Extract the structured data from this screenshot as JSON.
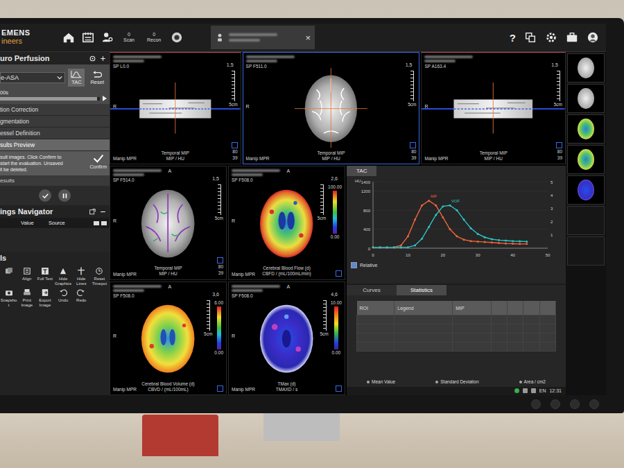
{
  "brand": {
    "text": "EMENS",
    "sub": "ineers"
  },
  "toolbar": {
    "counters": [
      {
        "count": "0",
        "label": "Scan"
      },
      {
        "count": "0",
        "label": "Recon"
      }
    ]
  },
  "patient_tab": {
    "close": "×"
  },
  "help": "?",
  "left_panel": {
    "title": "uro Perfusion",
    "protocol": "e-ASA",
    "tac_button": "TAC",
    "reset_button": "Reset",
    "time_label": "00s",
    "time_level": 0.97,
    "steps": [
      {
        "label": "tion Correction",
        "selected": false
      },
      {
        "label": "gmentation",
        "selected": false
      },
      {
        "label": "essel Definition",
        "selected": false
      },
      {
        "label": "sults Preview",
        "selected": true
      }
    ],
    "message": [
      "sult images. Click Confirm to",
      "start the evaluation. Unsaved",
      "ll be deleted."
    ],
    "confirm": "Confirm",
    "results": "esults"
  },
  "findings_navigator": {
    "title": "ings Navigator",
    "columns": [
      "Value",
      "Source"
    ]
  },
  "tools": {
    "title": "ls",
    "items": [
      {
        "label": ""
      },
      {
        "label": "Align"
      },
      {
        "label": "Full Text"
      },
      {
        "label": "Hide Graphics"
      },
      {
        "label": "Hide Lines"
      },
      {
        "label": "Reset Timepoi"
      },
      {
        "label": "Snapshot"
      },
      {
        "label": "Print Image"
      },
      {
        "label": "Export Image"
      },
      {
        "label": "Undo"
      },
      {
        "label": "Redo"
      }
    ]
  },
  "viewports_top": [
    {
      "kind": "strip",
      "selected": false,
      "sp": "SP L0.0",
      "method": "Manip MPR",
      "title": "Temporal MIP",
      "unit": "MIP / HU",
      "zoom": "1,5",
      "ruler": "5cm",
      "wl": [
        "80",
        "39"
      ],
      "top_marker": "",
      "left_marker": "R",
      "scale_max": "",
      "scale_min": ""
    },
    {
      "kind": "axial",
      "selected": true,
      "sp": "SP F511.0",
      "method": "Manip MPR",
      "title": "Temporal MIP",
      "unit": "MIP / HU",
      "zoom": "1,5",
      "ruler": "5cm",
      "wl": [
        "80",
        "39"
      ],
      "top_marker": "",
      "left_marker": "R",
      "scale_max": "",
      "scale_min": ""
    },
    {
      "kind": "strip",
      "selected": false,
      "sp": "SP A163.4",
      "method": "Manip MPR",
      "title": "Temporal MIP",
      "unit": "MIP / HU",
      "zoom": "1,5",
      "ruler": "5cm",
      "wl": [
        "80",
        "39"
      ],
      "top_marker": "",
      "left_marker": "R",
      "scale_max": "",
      "scale_min": ""
    }
  ],
  "viewports_bottom": [
    {
      "kind": "vessel",
      "selected": false,
      "sp": "SP F514.0",
      "method": "Manip MPR",
      "title": "Temporal MIP",
      "unit": "MIP / HU",
      "zoom": "1,5",
      "ruler": "5cm",
      "wl": [
        "80",
        "39"
      ],
      "top_marker": "A",
      "left_marker": "R",
      "scale_max": "",
      "scale_min": ""
    },
    {
      "kind": "cbf",
      "selected": false,
      "sp": "SP F508.0",
      "method": "Manip MPR",
      "title": "Cerebral Blood Flow (d)",
      "unit": "CBFD / (mL/100mL/min)",
      "zoom": "2,6",
      "ruler": "5cm",
      "wl": [],
      "top_marker": "A",
      "left_marker": "R",
      "scale_max": "100.00",
      "scale_min": "0.00"
    },
    {
      "kind": "cbv",
      "selected": false,
      "sp": "SP F508.0",
      "method": "Manip MPR",
      "title": "Cerebral Blood Volume (d)",
      "unit": "CBVD / (mL/100mL)",
      "zoom": "3,6",
      "ruler": "5cm",
      "wl": [],
      "top_marker": "A",
      "left_marker": "R",
      "scale_max": "6.00",
      "scale_min": "0.00"
    },
    {
      "kind": "tmax",
      "selected": false,
      "sp": "SP F508.0",
      "method": "Manip MPR",
      "title": "TMax (d)",
      "unit": "TMAXD / s",
      "zoom": "4,6",
      "ruler": "5cm",
      "wl": [],
      "top_marker": "A",
      "left_marker": "R",
      "scale_max": "10.00",
      "scale_min": "0.00"
    }
  ],
  "tac": {
    "tab": "TAC",
    "y_unit": "HU",
    "y_ticks": [
      "0",
      "400",
      "800",
      "1200",
      "1400"
    ],
    "right_ticks": [
      "1",
      "2",
      "3",
      "4",
      "5"
    ],
    "x_ticks": [
      "0",
      "10",
      "20",
      "30",
      "40",
      "50"
    ],
    "times": [
      0,
      2,
      4,
      6,
      8,
      10,
      12,
      14,
      16,
      18,
      20,
      22,
      24,
      26,
      28,
      30,
      32,
      34,
      36,
      38,
      40,
      42,
      44
    ],
    "series": [
      {
        "name": "AIF",
        "color": "#f0643c",
        "values": [
          20,
          20,
          20,
          20,
          60,
          250,
          600,
          900,
          1000,
          900,
          650,
          400,
          250,
          180,
          150,
          140,
          130,
          120,
          110,
          100,
          95,
          90,
          90
        ]
      },
      {
        "name": "VOF",
        "color": "#2ec4c4",
        "values": [
          20,
          20,
          20,
          20,
          20,
          20,
          60,
          200,
          450,
          700,
          880,
          900,
          800,
          600,
          420,
          300,
          230,
          190,
          170,
          160,
          150,
          145,
          140
        ]
      }
    ],
    "relative": {
      "label": "Relative",
      "checked": true
    }
  },
  "stats": {
    "tabs": [
      {
        "label": "Curves",
        "selected": false
      },
      {
        "label": "Statistics",
        "selected": true
      }
    ],
    "columns": [
      "ROI",
      "Legend",
      "MIP"
    ],
    "legend": [
      {
        "label": "Mean Value"
      },
      {
        "label": "Standard Deviation"
      },
      {
        "label": "Area / cm2"
      }
    ]
  },
  "taskbar": {
    "language": "EN",
    "time": "12:31"
  },
  "thumbnails": [
    {
      "kind": "gray"
    },
    {
      "kind": "gray"
    },
    {
      "kind": "color"
    },
    {
      "kind": "color"
    },
    {
      "kind": "blue"
    }
  ]
}
